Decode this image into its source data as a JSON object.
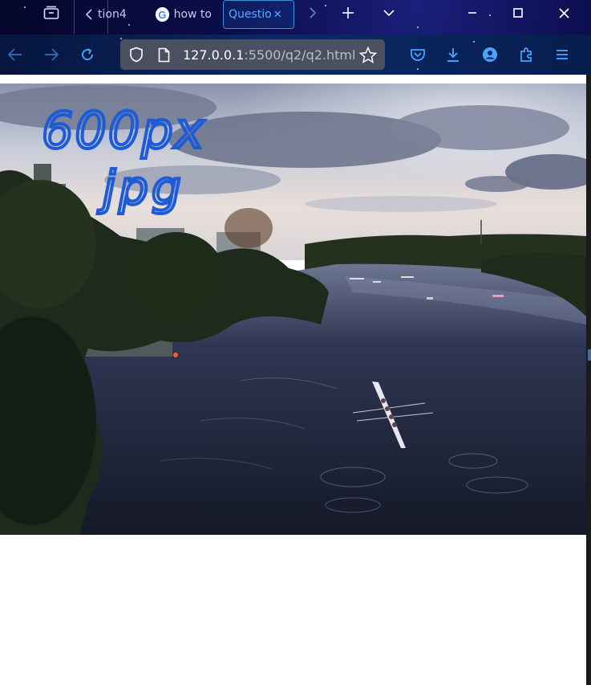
{
  "tabs": {
    "partial_prev_label": "tion4",
    "google_tab_label": "how to",
    "google_letter": "G",
    "active_label": "Questio",
    "active_close": "✕"
  },
  "navigation": {
    "url_host": "127.0.0.1",
    "url_path": ":5500/q2/q2.html"
  },
  "annotation": {
    "line1": "600px",
    "line2": "jpg"
  },
  "colors": {
    "accent": "#3a8fe0",
    "handwriting": "#1e5bd6",
    "nav_icon": "#4aa3ff"
  },
  "icons": [
    "tab-overview-icon",
    "chevron-left-icon",
    "google-icon",
    "close-icon",
    "chevron-right-icon",
    "new-tab-icon",
    "list-tabs-icon",
    "minimize-icon",
    "maximize-icon",
    "window-close-icon",
    "back-icon",
    "forward-icon",
    "reload-icon",
    "shield-icon",
    "page-icon",
    "star-icon",
    "pocket-icon",
    "download-icon",
    "account-icon",
    "extensions-icon",
    "menu-icon"
  ]
}
